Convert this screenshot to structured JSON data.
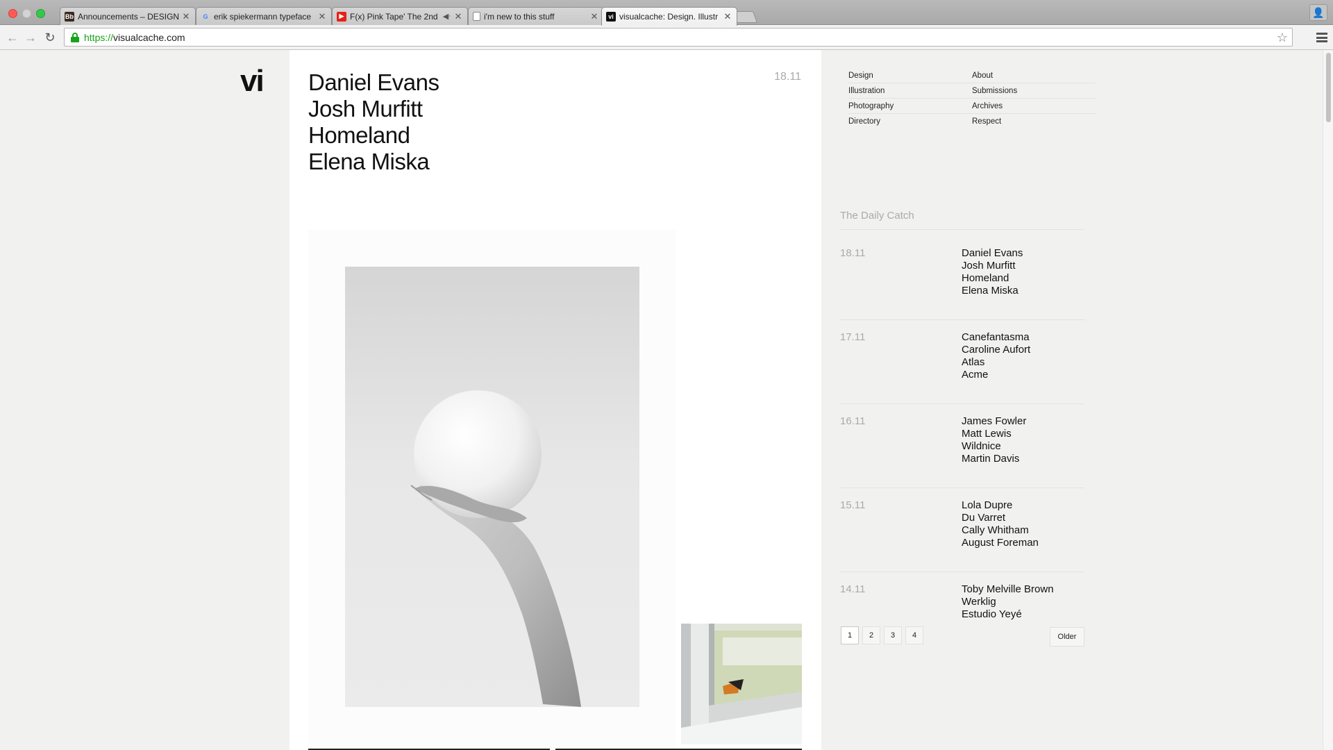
{
  "browser": {
    "tabs": [
      {
        "title": "Announcements – DESIGN",
        "favicon": "bb",
        "active": false
      },
      {
        "title": "erik spiekermann typeface",
        "favicon": "google",
        "active": false
      },
      {
        "title": "F(x) Pink Tape' The 2nd",
        "favicon": "youtube",
        "active": false
      },
      {
        "title": "i'm new to this stuff",
        "favicon": "document",
        "active": false
      },
      {
        "title": "visualcache: Design. Illustr",
        "favicon": "vi",
        "active": true
      }
    ],
    "url_scheme": "https://",
    "url_host": "visualcache.com"
  },
  "site": {
    "logo": "vi",
    "post": {
      "titles": [
        "Daniel Evans",
        "Josh Murfitt",
        "Homeland",
        "Elena Miska"
      ],
      "date": "18.11"
    },
    "nav": [
      {
        "left": "Design",
        "right": "About"
      },
      {
        "left": "Illustration",
        "right": "Submissions"
      },
      {
        "left": "Photography",
        "right": "Archives"
      },
      {
        "left": "Directory",
        "right": "Respect"
      }
    ],
    "daily_catch": {
      "title": "The Daily Catch",
      "days": [
        {
          "date": "18.11",
          "names": [
            "Daniel Evans",
            "Josh Murfitt",
            "Homeland",
            "Elena Miska"
          ]
        },
        {
          "date": "17.11",
          "names": [
            "Canefantasma",
            "Caroline Aufort",
            "Atlas",
            "Acme"
          ]
        },
        {
          "date": "16.11",
          "names": [
            "James Fowler",
            "Matt Lewis",
            "Wildnice",
            "Martin Davis"
          ]
        },
        {
          "date": "15.11",
          "names": [
            "Lola Dupre",
            "Du Varret",
            "Cally Whitham",
            "August Foreman"
          ]
        },
        {
          "date": "14.11",
          "names": [
            "Toby Melville Brown",
            "Werklig",
            "Estudio Yeyé"
          ]
        }
      ]
    },
    "pagination": {
      "pages": [
        "1",
        "2",
        "3",
        "4"
      ],
      "current": "1",
      "older_label": "Older"
    }
  }
}
